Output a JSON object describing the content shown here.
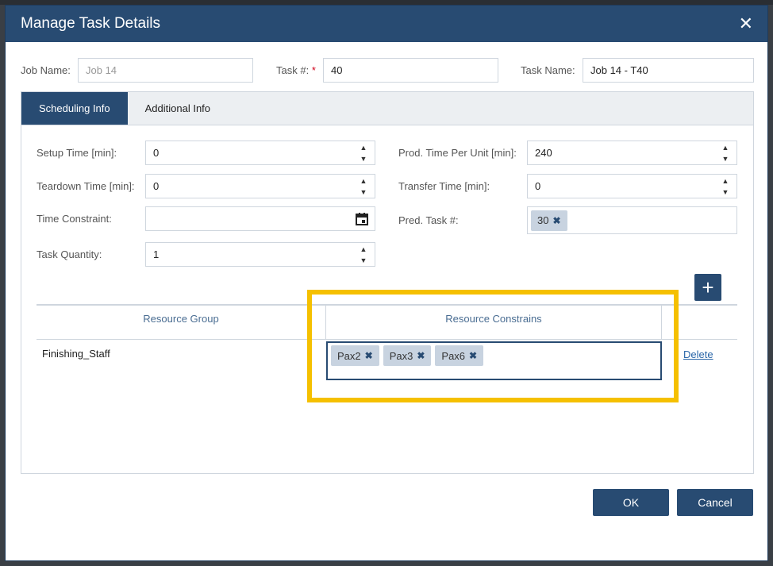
{
  "dialog": {
    "title": "Manage Task Details",
    "close_glyph": "✕"
  },
  "header_fields": {
    "job_name_label": "Job Name:",
    "job_name_value": "Job 14",
    "task_num_label": "Task #:",
    "task_num_required": "*",
    "task_num_value": "40",
    "task_name_label": "Task Name:",
    "task_name_value": "Job 14 - T40"
  },
  "tabs": [
    {
      "label": "Scheduling Info",
      "active": true
    },
    {
      "label": "Additional Info",
      "active": false
    }
  ],
  "scheduling": {
    "setup_time_label": "Setup Time [min]:",
    "setup_time_value": "0",
    "teardown_time_label": "Teardown Time [min]:",
    "teardown_time_value": "0",
    "time_constraint_label": "Time Constraint:",
    "time_constraint_value": "",
    "task_quantity_label": "Task Quantity:",
    "task_quantity_value": "1",
    "prod_time_label": "Prod. Time Per Unit [min]:",
    "prod_time_value": "240",
    "transfer_time_label": "Transfer Time [min]:",
    "transfer_time_value": "0",
    "pred_task_label": "Pred. Task #:",
    "pred_task_chips": [
      "30"
    ]
  },
  "resource_table": {
    "add_button_glyph": "+",
    "columns": [
      "Resource Group",
      "Resource Constrains"
    ],
    "rows": [
      {
        "group": "Finishing_Staff",
        "constraints": [
          "Pax2",
          "Pax3",
          "Pax6"
        ],
        "action": "Delete"
      }
    ]
  },
  "footer": {
    "ok_label": "OK",
    "cancel_label": "Cancel"
  },
  "colors": {
    "primary": "#284b72",
    "highlight": "#f5c000",
    "chip_bg": "#c8d3e0",
    "link": "#2a66a8"
  },
  "icons": {
    "spinner_up": "▲",
    "spinner_down": "▼",
    "chip_remove": "✖"
  }
}
